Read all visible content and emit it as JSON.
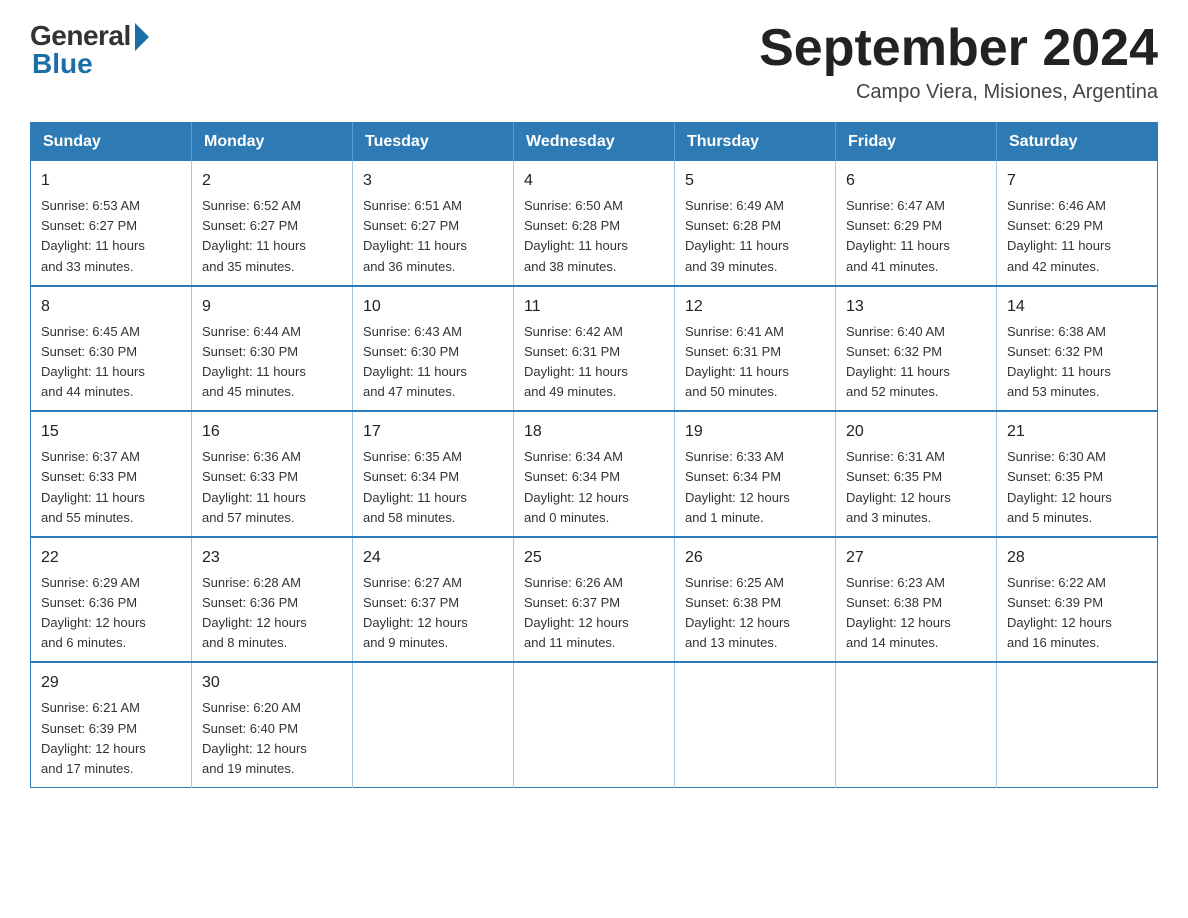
{
  "logo": {
    "general_text": "General",
    "blue_text": "Blue"
  },
  "title": "September 2024",
  "subtitle": "Campo Viera, Misiones, Argentina",
  "days_of_week": [
    "Sunday",
    "Monday",
    "Tuesday",
    "Wednesday",
    "Thursday",
    "Friday",
    "Saturday"
  ],
  "weeks": [
    [
      {
        "day": "1",
        "sunrise": "6:53 AM",
        "sunset": "6:27 PM",
        "daylight": "11 hours and 33 minutes."
      },
      {
        "day": "2",
        "sunrise": "6:52 AM",
        "sunset": "6:27 PM",
        "daylight": "11 hours and 35 minutes."
      },
      {
        "day": "3",
        "sunrise": "6:51 AM",
        "sunset": "6:27 PM",
        "daylight": "11 hours and 36 minutes."
      },
      {
        "day": "4",
        "sunrise": "6:50 AM",
        "sunset": "6:28 PM",
        "daylight": "11 hours and 38 minutes."
      },
      {
        "day": "5",
        "sunrise": "6:49 AM",
        "sunset": "6:28 PM",
        "daylight": "11 hours and 39 minutes."
      },
      {
        "day": "6",
        "sunrise": "6:47 AM",
        "sunset": "6:29 PM",
        "daylight": "11 hours and 41 minutes."
      },
      {
        "day": "7",
        "sunrise": "6:46 AM",
        "sunset": "6:29 PM",
        "daylight": "11 hours and 42 minutes."
      }
    ],
    [
      {
        "day": "8",
        "sunrise": "6:45 AM",
        "sunset": "6:30 PM",
        "daylight": "11 hours and 44 minutes."
      },
      {
        "day": "9",
        "sunrise": "6:44 AM",
        "sunset": "6:30 PM",
        "daylight": "11 hours and 45 minutes."
      },
      {
        "day": "10",
        "sunrise": "6:43 AM",
        "sunset": "6:30 PM",
        "daylight": "11 hours and 47 minutes."
      },
      {
        "day": "11",
        "sunrise": "6:42 AM",
        "sunset": "6:31 PM",
        "daylight": "11 hours and 49 minutes."
      },
      {
        "day": "12",
        "sunrise": "6:41 AM",
        "sunset": "6:31 PM",
        "daylight": "11 hours and 50 minutes."
      },
      {
        "day": "13",
        "sunrise": "6:40 AM",
        "sunset": "6:32 PM",
        "daylight": "11 hours and 52 minutes."
      },
      {
        "day": "14",
        "sunrise": "6:38 AM",
        "sunset": "6:32 PM",
        "daylight": "11 hours and 53 minutes."
      }
    ],
    [
      {
        "day": "15",
        "sunrise": "6:37 AM",
        "sunset": "6:33 PM",
        "daylight": "11 hours and 55 minutes."
      },
      {
        "day": "16",
        "sunrise": "6:36 AM",
        "sunset": "6:33 PM",
        "daylight": "11 hours and 57 minutes."
      },
      {
        "day": "17",
        "sunrise": "6:35 AM",
        "sunset": "6:34 PM",
        "daylight": "11 hours and 58 minutes."
      },
      {
        "day": "18",
        "sunrise": "6:34 AM",
        "sunset": "6:34 PM",
        "daylight": "12 hours and 0 minutes."
      },
      {
        "day": "19",
        "sunrise": "6:33 AM",
        "sunset": "6:34 PM",
        "daylight": "12 hours and 1 minute."
      },
      {
        "day": "20",
        "sunrise": "6:31 AM",
        "sunset": "6:35 PM",
        "daylight": "12 hours and 3 minutes."
      },
      {
        "day": "21",
        "sunrise": "6:30 AM",
        "sunset": "6:35 PM",
        "daylight": "12 hours and 5 minutes."
      }
    ],
    [
      {
        "day": "22",
        "sunrise": "6:29 AM",
        "sunset": "6:36 PM",
        "daylight": "12 hours and 6 minutes."
      },
      {
        "day": "23",
        "sunrise": "6:28 AM",
        "sunset": "6:36 PM",
        "daylight": "12 hours and 8 minutes."
      },
      {
        "day": "24",
        "sunrise": "6:27 AM",
        "sunset": "6:37 PM",
        "daylight": "12 hours and 9 minutes."
      },
      {
        "day": "25",
        "sunrise": "6:26 AM",
        "sunset": "6:37 PM",
        "daylight": "12 hours and 11 minutes."
      },
      {
        "day": "26",
        "sunrise": "6:25 AM",
        "sunset": "6:38 PM",
        "daylight": "12 hours and 13 minutes."
      },
      {
        "day": "27",
        "sunrise": "6:23 AM",
        "sunset": "6:38 PM",
        "daylight": "12 hours and 14 minutes."
      },
      {
        "day": "28",
        "sunrise": "6:22 AM",
        "sunset": "6:39 PM",
        "daylight": "12 hours and 16 minutes."
      }
    ],
    [
      {
        "day": "29",
        "sunrise": "6:21 AM",
        "sunset": "6:39 PM",
        "daylight": "12 hours and 17 minutes."
      },
      {
        "day": "30",
        "sunrise": "6:20 AM",
        "sunset": "6:40 PM",
        "daylight": "12 hours and 19 minutes."
      },
      null,
      null,
      null,
      null,
      null
    ]
  ],
  "labels": {
    "sunrise": "Sunrise:",
    "sunset": "Sunset:",
    "daylight": "Daylight:"
  }
}
